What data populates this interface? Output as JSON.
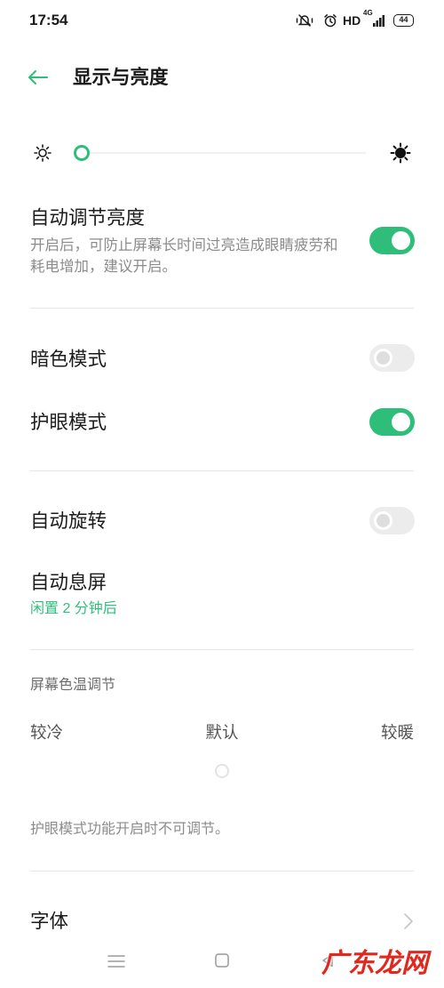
{
  "status_bar": {
    "time": "17:54",
    "icons": [
      "mute-vibrate-icon",
      "alarm-icon",
      "signal-bars-icon",
      "battery-icon"
    ],
    "network_label": "HD",
    "signal_label": "4G",
    "battery_level": "44"
  },
  "header": {
    "back_icon": "back-arrow-icon",
    "title": "显示与亮度"
  },
  "brightness": {
    "min_icon": "sun-outline-icon",
    "max_icon": "sun-filled-icon",
    "level": 0
  },
  "settings": {
    "auto_brightness": {
      "label": "自动调节亮度",
      "description_lines": [
        "开启后，可防止屏幕长时间过亮造成眼睛疲劳和",
        "耗电增加，建议开启。"
      ],
      "enabled": true
    },
    "dark_mode": {
      "label": "暗色模式",
      "enabled": false
    },
    "eye_protection": {
      "label": "护眼模式",
      "enabled": true
    },
    "auto_rotate": {
      "label": "自动旋转",
      "enabled": false
    },
    "screen_timeout": {
      "label": "自动息屏",
      "value": "闲置 2 分钟后"
    }
  },
  "color_temperature": {
    "title": "屏幕色温调节",
    "labels": {
      "cool": "较冷",
      "default": "默认",
      "warm": "较暖"
    },
    "level": 0.5,
    "disabled": true,
    "note": "护眼模式功能开启时不可调节。"
  },
  "font": {
    "label": "字体",
    "chevron_icon": "chevron-right-icon"
  },
  "nav_bar": {
    "icons": [
      "menu-icon",
      "home-icon",
      "back-icon"
    ]
  },
  "watermark": "广东龙网",
  "colors": {
    "accent": "#2fbe7a",
    "watermark": "#e0281e"
  }
}
